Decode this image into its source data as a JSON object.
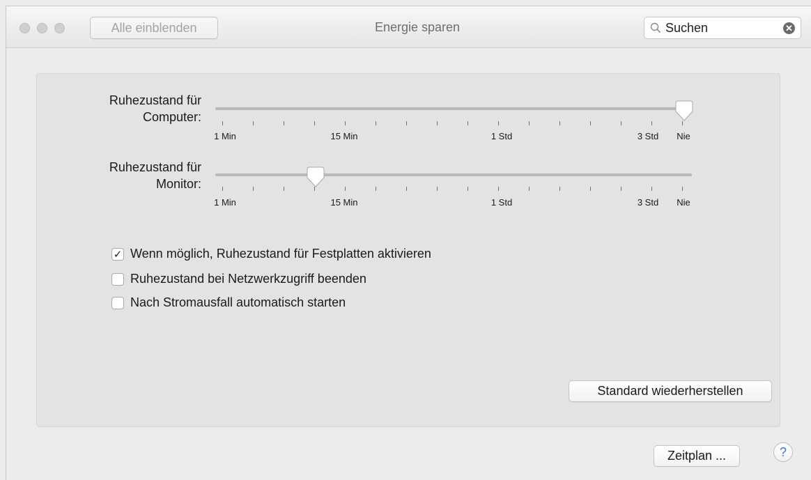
{
  "window": {
    "title": "Energie sparen",
    "show_all_label": "Alle einblenden",
    "search": {
      "value": "Suchen",
      "icon": "search-icon",
      "clear_icon": "clear-icon"
    }
  },
  "sliders": [
    {
      "label_line1": "Ruhezustand für",
      "label_line2": "Computer:",
      "value": "Nie",
      "tick_labels": [
        "1 Min",
        "15 Min",
        "1 Std",
        "3 Std",
        "Nie"
      ]
    },
    {
      "label_line1": "Ruhezustand für",
      "label_line2": "Monitor:",
      "value": "15 Min",
      "tick_labels": [
        "1 Min",
        "15 Min",
        "1 Std",
        "3 Std",
        "Nie"
      ]
    }
  ],
  "checkboxes": [
    {
      "label": "Wenn möglich, Ruhezustand für Festplatten aktivieren",
      "checked": true,
      "check_glyph": "✓"
    },
    {
      "label": "Ruhezustand bei Netzwerkzugriff beenden",
      "checked": false,
      "check_glyph": ""
    },
    {
      "label": "Nach Stromausfall automatisch starten",
      "checked": false,
      "check_glyph": ""
    }
  ],
  "buttons": {
    "restore_defaults": "Standard wiederherstellen",
    "schedule": "Zeitplan ...",
    "help": "?"
  },
  "colors": {
    "accent": "#3b78d8",
    "traffic_inactive": "#cfcfcf"
  }
}
